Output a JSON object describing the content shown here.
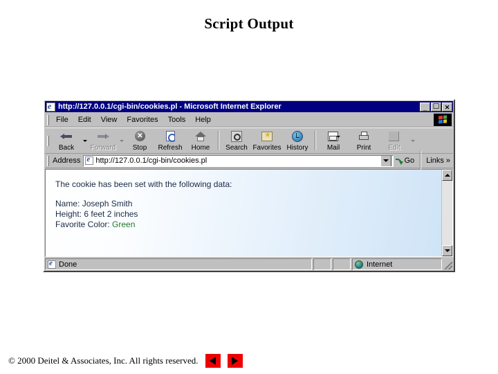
{
  "slide": {
    "title": "Script Output"
  },
  "browser": {
    "titlebar": {
      "text": "http://127.0.0.1/cgi-bin/cookies.pl - Microsoft Internet Explorer",
      "icon": "ie-document-icon",
      "minimize_label": "_",
      "maximize_label": "☐",
      "close_label": "✕"
    },
    "menu": {
      "items": [
        {
          "label": "File"
        },
        {
          "label": "Edit"
        },
        {
          "label": "View"
        },
        {
          "label": "Favorites"
        },
        {
          "label": "Tools"
        },
        {
          "label": "Help"
        }
      ],
      "logo": "windows-flag-logo"
    },
    "toolbar": {
      "buttons": [
        {
          "label": "Back",
          "icon": "back-arrow-icon",
          "disabled": false,
          "dropdown": true
        },
        {
          "label": "Forward",
          "icon": "forward-arrow-icon",
          "disabled": true,
          "dropdown": true
        },
        {
          "label": "Stop",
          "icon": "stop-icon",
          "disabled": false,
          "dropdown": false
        },
        {
          "label": "Refresh",
          "icon": "refresh-icon",
          "disabled": false,
          "dropdown": false
        },
        {
          "label": "Home",
          "icon": "home-icon",
          "disabled": false,
          "dropdown": false
        },
        {
          "label": "Search",
          "icon": "search-icon",
          "disabled": false,
          "dropdown": false
        },
        {
          "label": "Favorites",
          "icon": "favorites-star-icon",
          "disabled": false,
          "dropdown": false
        },
        {
          "label": "History",
          "icon": "history-clock-icon",
          "disabled": false,
          "dropdown": false
        },
        {
          "label": "Mail",
          "icon": "mail-icon",
          "disabled": false,
          "dropdown": true
        },
        {
          "label": "Print",
          "icon": "printer-icon",
          "disabled": false,
          "dropdown": false
        },
        {
          "label": "Edit",
          "icon": "edit-icon",
          "disabled": true,
          "dropdown": true
        }
      ]
    },
    "address": {
      "label": "Address",
      "url": "http://127.0.0.1/cgi-bin/cookies.pl",
      "placeholder": "http://",
      "go_label": "Go",
      "links_label": "Links",
      "links_chevron": "»"
    },
    "page": {
      "heading": "The cookie has been set with the following data:",
      "fields": [
        {
          "label": "Name: ",
          "value": "Joseph Smith",
          "value_color": "#1a2a44"
        },
        {
          "label": "Height: ",
          "value": "6 feet 2 inches",
          "value_color": "#1a2a44"
        },
        {
          "label": "Favorite Color: ",
          "value": "Green",
          "value_color": "#1f7a2f"
        }
      ]
    },
    "statusbar": {
      "status_text": "Done",
      "zone_text": "Internet",
      "status_icon": "page-icon",
      "zone_icon": "globe-icon"
    },
    "scrollbar": {
      "up_label": "▲",
      "down_label": "▼"
    }
  },
  "footer": {
    "copyright": "© 2000 Deitel & Associates, Inc.  All rights reserved.",
    "prev_label": "previous-slide",
    "next_label": "next-slide"
  }
}
